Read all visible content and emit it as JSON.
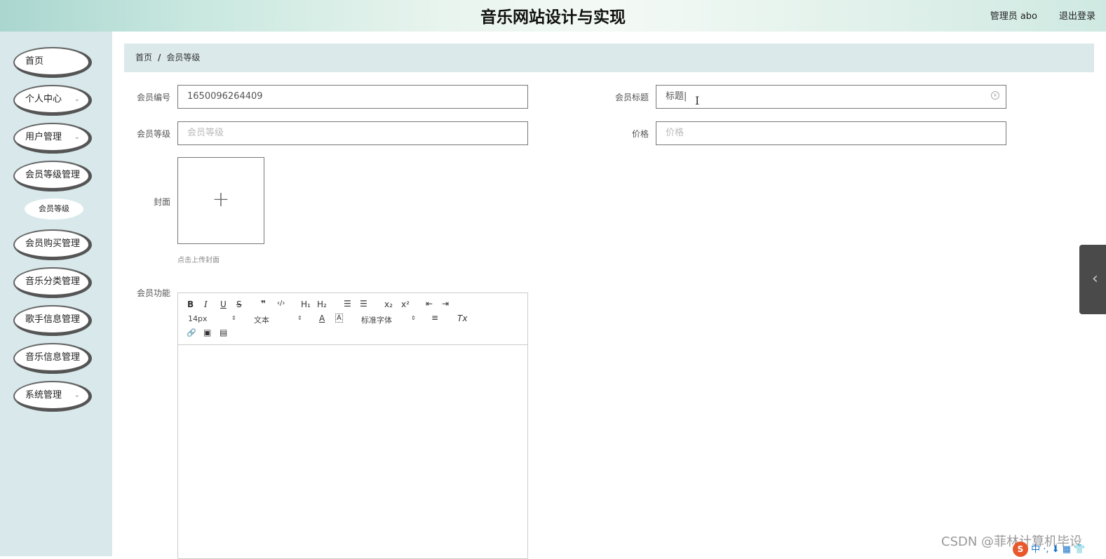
{
  "header": {
    "title": "音乐网站设计与实现",
    "user": "管理员 abo",
    "logout": "退出登录"
  },
  "sidebar": {
    "items": [
      {
        "label": "首页",
        "has_chevron": false
      },
      {
        "label": "个人中心",
        "has_chevron": true
      },
      {
        "label": "用户管理",
        "has_chevron": true
      },
      {
        "label": "会员等级管理",
        "has_chevron": false
      },
      {
        "label": "会员购买管理",
        "has_chevron": false
      },
      {
        "label": "音乐分类管理",
        "has_chevron": false
      },
      {
        "label": "歌手信息管理",
        "has_chevron": false
      },
      {
        "label": "音乐信息管理",
        "has_chevron": false
      },
      {
        "label": "系统管理",
        "has_chevron": true
      }
    ],
    "submenu": {
      "label": "会员等级"
    },
    "chevron": "⌄"
  },
  "breadcrumb": {
    "home": "首页",
    "separator": "/",
    "current": "会员等级"
  },
  "form": {
    "member_id": {
      "label": "会员编号",
      "value": "1650096264409"
    },
    "member_title": {
      "label": "会员标题",
      "value": "标题|"
    },
    "member_level": {
      "label": "会员等级",
      "placeholder": "会员等级"
    },
    "price": {
      "label": "价格",
      "placeholder": "价格"
    },
    "cover": {
      "label": "封面",
      "plus": "+",
      "tip": "点击上传封面"
    },
    "features": {
      "label": "会员功能"
    }
  },
  "editor": {
    "buttons_row1": [
      "B",
      "I",
      "U",
      "S",
      "❞",
      "‹/›",
      "H₁",
      "H₂",
      "☰",
      "☰",
      "x₂",
      "x²",
      "⇤",
      "⇥"
    ],
    "font_size": "14px",
    "text_style": "文本",
    "color_icon": "A",
    "bg_icon": "A",
    "font_family": "标准字体",
    "align_icon": "≡",
    "clear_format": "Tx",
    "buttons_row3": [
      "🔗",
      "▣",
      "▤"
    ],
    "select_arrow": "⇕"
  },
  "overlay": {
    "watermark": "CSDN @菲林计算机毕设",
    "ime_logo": "S",
    "ime_text": "中 ·, ⬇ ▦ 👕",
    "side_tab_arrow": "‹",
    "clear_icon": "×",
    "text_cursor": "I"
  }
}
